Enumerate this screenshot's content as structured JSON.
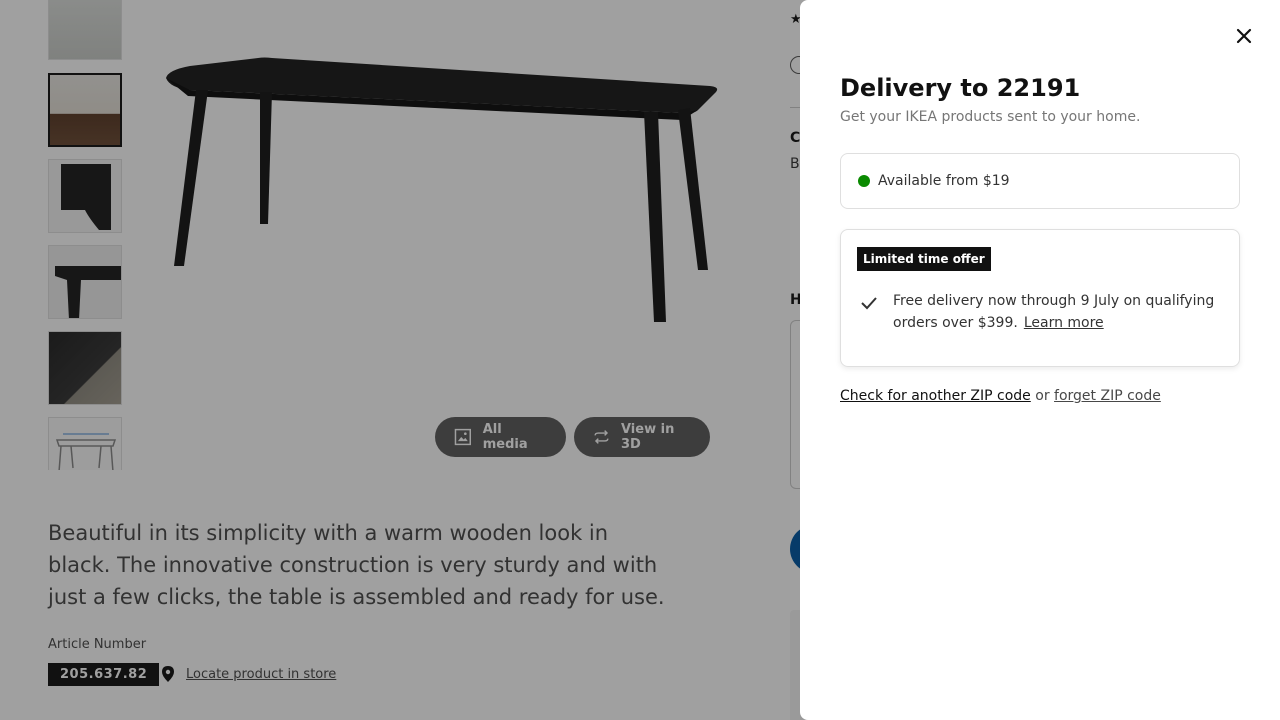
{
  "product_page": {
    "thumbnails": [
      {
        "label": "dining-room-photo"
      },
      {
        "label": "dining-room-table-photo"
      },
      {
        "label": "table-edge-detail"
      },
      {
        "label": "table-corner-detail"
      },
      {
        "label": "assembly-detail"
      },
      {
        "label": "dimensions-drawing"
      }
    ],
    "media_buttons": {
      "all_media": "All media",
      "view_3d": "View in 3D"
    },
    "description": "Beautiful in its simplicity with a warm wooden look in black. The innovative construction is very sturdy and with just a few clicks, the table is assembled and ready for use.",
    "article_label": "Article Number",
    "article_number": "205.637.82",
    "locate_link": "Locate product in store",
    "right_column": {
      "c_letter": "C",
      "b_letter": "B",
      "h_letter": "H"
    }
  },
  "delivery_panel": {
    "title": "Delivery to 22191",
    "subtitle": "Get your IKEA products sent to your home.",
    "availability": "Available from $19",
    "offer_badge": "Limited time offer",
    "offer_text": "Free delivery now through 9 July on qualifying orders over $399.",
    "learn_more": "Learn more",
    "check_zip": "Check for another ZIP code",
    "or_text": "or",
    "forget_zip": "forget ZIP code"
  },
  "colors": {
    "available": "#0a8a00",
    "badge_bg": "#111111",
    "overlay": "rgba(17,17,17,0.4)"
  }
}
